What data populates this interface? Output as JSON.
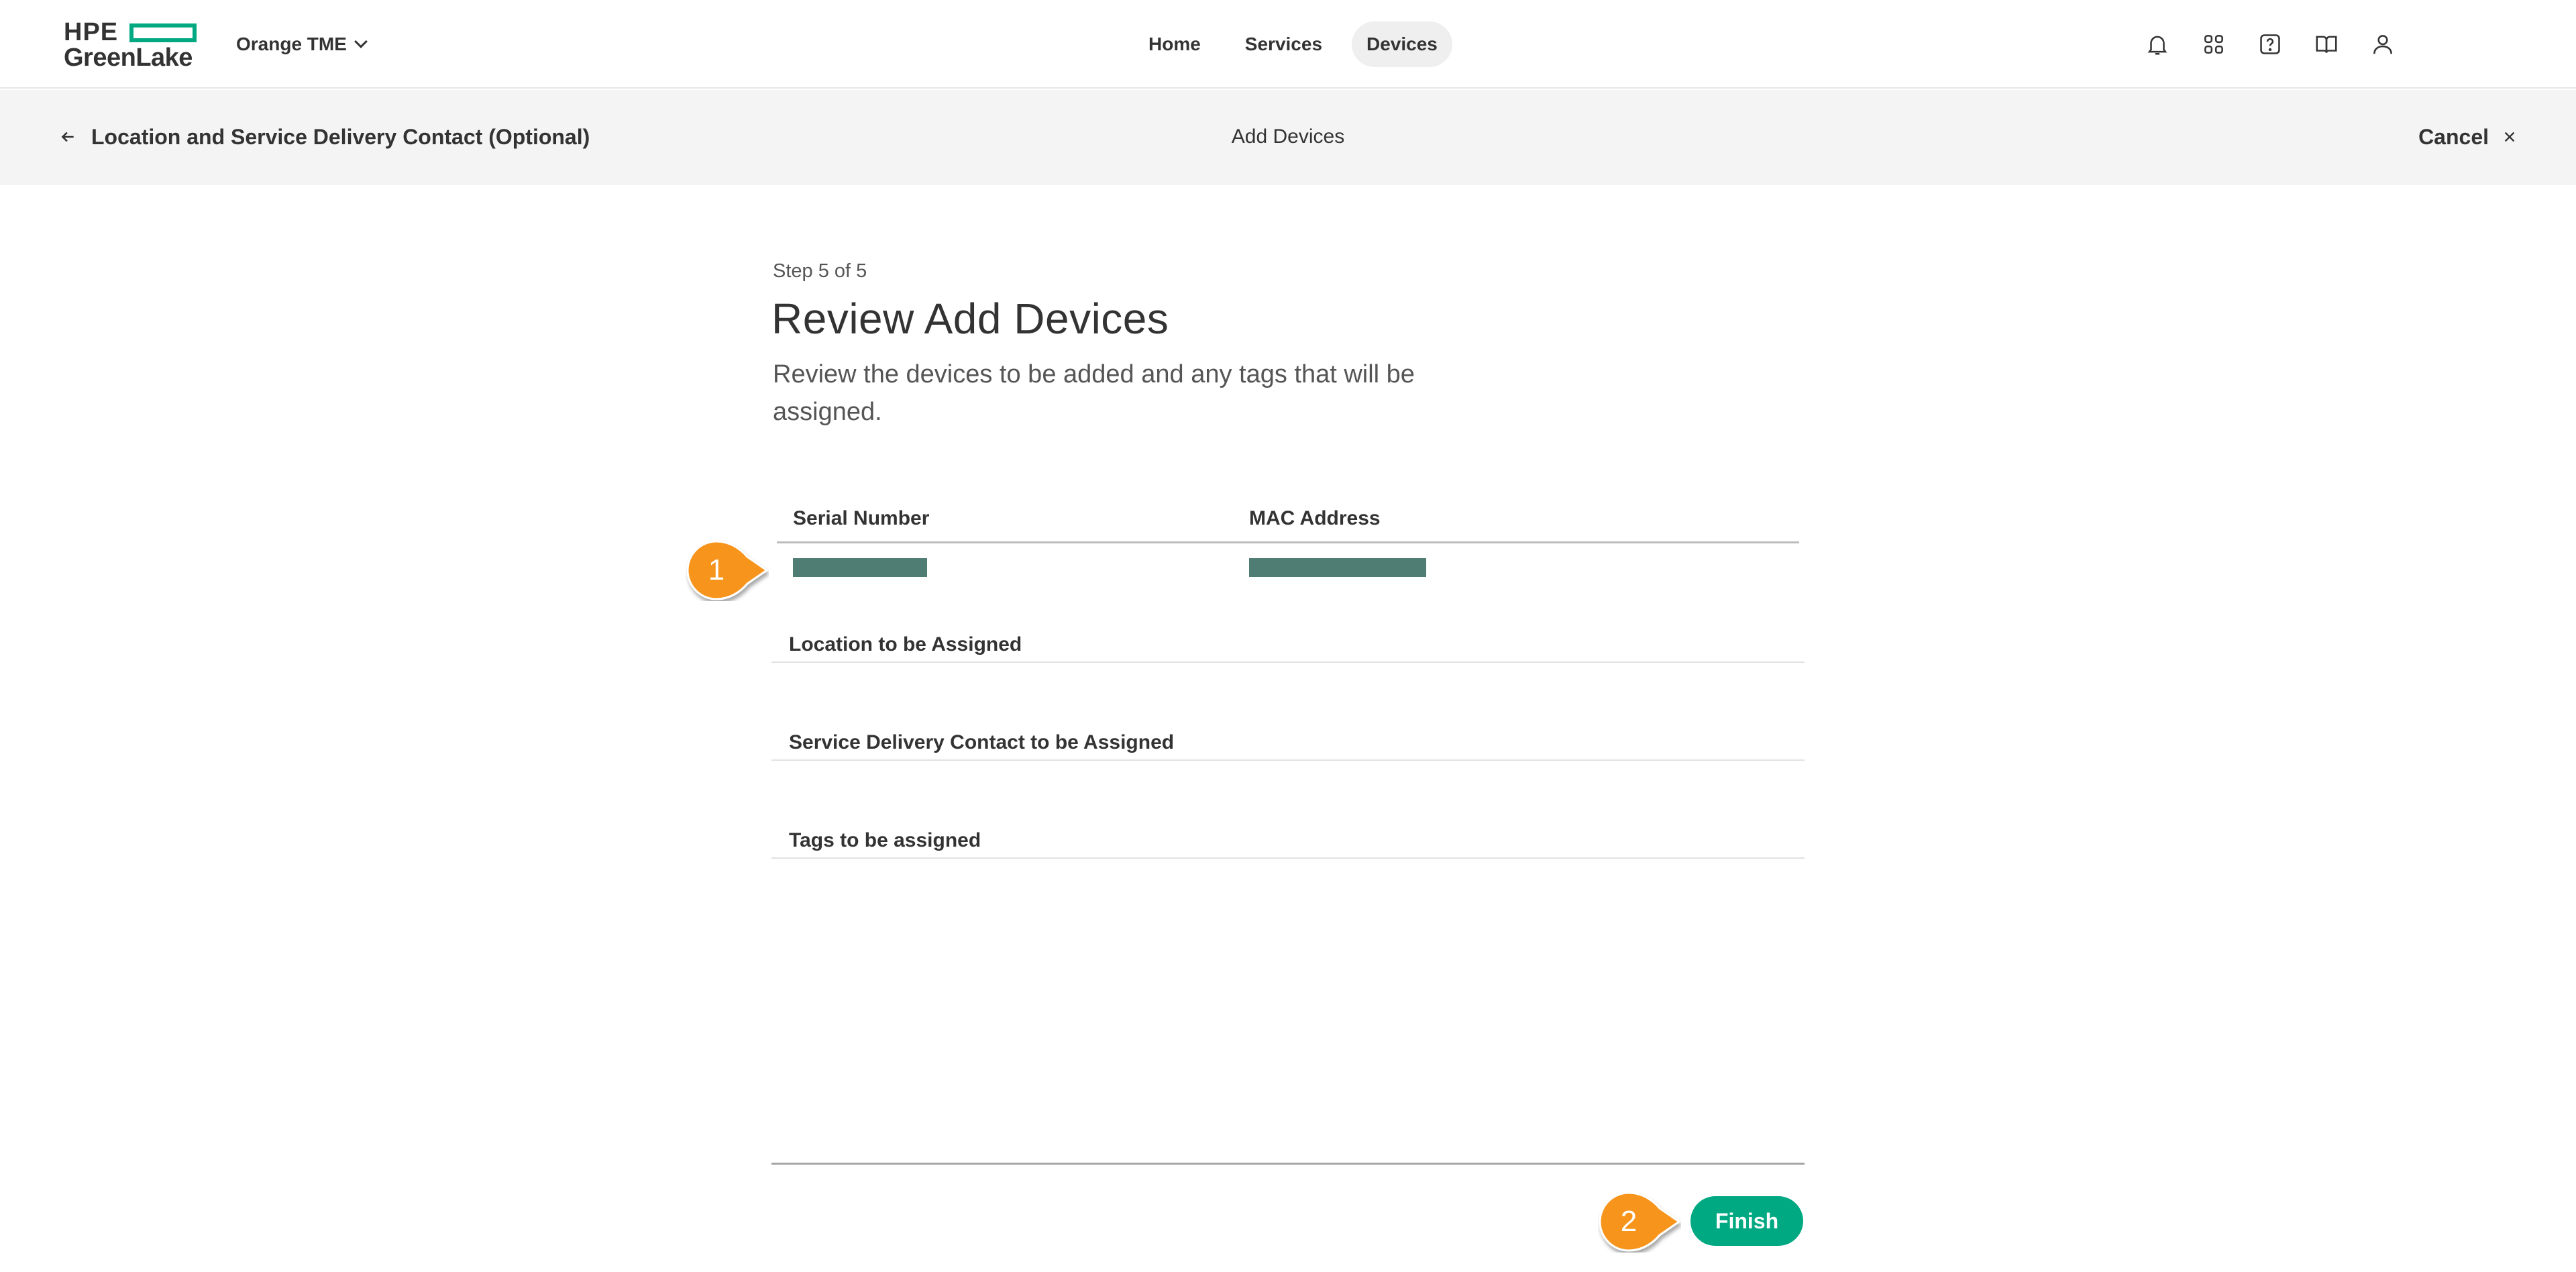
{
  "brand": {
    "line1": "HPE",
    "line2": "GreenLake",
    "accent": "#01a982"
  },
  "workspace": {
    "name": "Orange TME"
  },
  "nav": {
    "links": [
      {
        "label": "Home",
        "active": false
      },
      {
        "label": "Services",
        "active": false
      },
      {
        "label": "Devices",
        "active": true
      }
    ],
    "icons": [
      "bell-icon",
      "apps-grid-icon",
      "help-icon",
      "book-icon",
      "user-icon"
    ]
  },
  "subheader": {
    "back_label": "Location and Service Delivery Contact (Optional)",
    "title": "Add Devices",
    "cancel_label": "Cancel"
  },
  "main": {
    "step": "Step 5 of 5",
    "title": "Review Add Devices",
    "description": "Review the devices to be added and any tags that will be assigned.",
    "table": {
      "columns": [
        "Serial Number",
        "MAC Address"
      ],
      "rows": [
        {
          "serial_redacted": true,
          "mac_redacted": true
        }
      ],
      "redaction_color": "#4f7d73"
    },
    "sections": [
      "Location to be Assigned",
      "Service Delivery Contact to be Assigned",
      "Tags to be assigned"
    ],
    "finish_label": "Finish"
  },
  "callouts": [
    {
      "number": "1"
    },
    {
      "number": "2"
    }
  ],
  "callout_color": "#f7941d"
}
